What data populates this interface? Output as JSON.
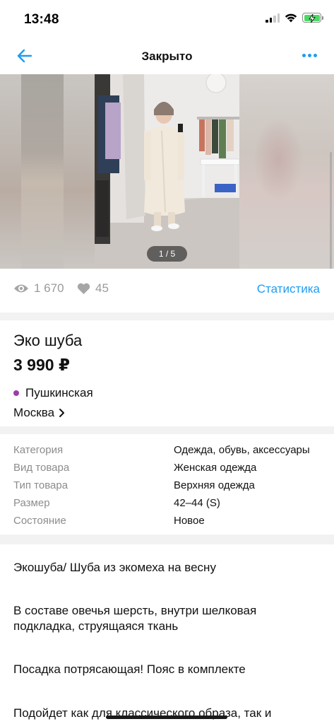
{
  "status_bar": {
    "time": "13:48"
  },
  "nav": {
    "title": "Закрыто",
    "back_icon": "arrow-left-icon",
    "more_icon": "more-dots-icon",
    "accent_color": "#1e9df2"
  },
  "gallery": {
    "counter": "1 / 5"
  },
  "stats": {
    "views": "1 670",
    "likes": "45",
    "statistics_link": "Статистика"
  },
  "item": {
    "title": "Эко шуба",
    "price": "3 990 ₽",
    "metro": "Пушкинская",
    "metro_color": "#9b3ea8",
    "city": "Москва"
  },
  "params": [
    {
      "label": "Категория",
      "value": "Одежда, обувь, аксессуары"
    },
    {
      "label": "Вид товара",
      "value": "Женская одежда"
    },
    {
      "label": "Тип товара",
      "value": "Верхняя одежда"
    },
    {
      "label": "Размер",
      "value": "42–44 (S)"
    },
    {
      "label": "Состояние",
      "value": "Новое"
    }
  ],
  "description": {
    "p1": "Экошуба/ Шуба из экомеха на весну",
    "p2": "В составе овечья шерсть, внутри шелковая подкладка, струящаяся ткань",
    "p3": "Посадка потрясающая! Пояс в комплекте",
    "p4": "Подойдет как для классического образа, так и"
  }
}
